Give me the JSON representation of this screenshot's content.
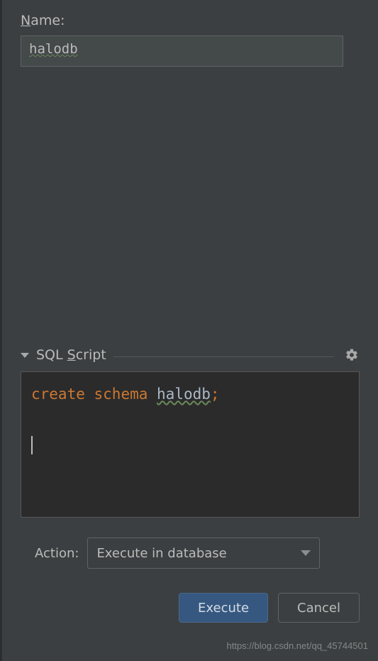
{
  "name_field": {
    "label": "Name:",
    "value": "halodb"
  },
  "sql_section": {
    "title": "SQL Script",
    "code": {
      "keyword_create": "create",
      "keyword_schema": "schema",
      "identifier": "halodb",
      "semicolon": ";"
    }
  },
  "action": {
    "label": "Action:",
    "selected": "Execute in database"
  },
  "buttons": {
    "execute": "Execute",
    "cancel": "Cancel"
  },
  "watermark": "https://blog.csdn.net/qq_45744501"
}
